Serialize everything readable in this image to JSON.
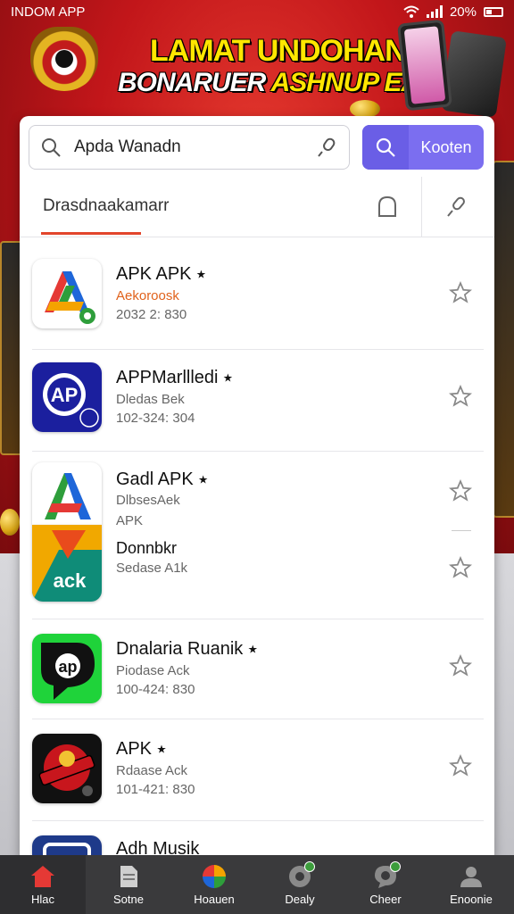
{
  "status_bar": {
    "carrier": "INDOM APP",
    "battery": "20%"
  },
  "banner": {
    "title_line1": "LAMAT UNDOHAN",
    "title_line2_a": "BONARUER ",
    "title_line2_b": "ASHNUP EAWS"
  },
  "search": {
    "query": "Apda Wanadn",
    "button_label": "Kooten"
  },
  "tabs": {
    "active_label": "Drasdnaakamarr"
  },
  "apps": [
    {
      "name": "APK APK ⭑",
      "sub1": "Aekoroosk",
      "sub2": "2032 2: 830",
      "sub1_color": "#e0621c"
    },
    {
      "name": "APPMarllledi ⭑",
      "sub1": "Dledas Bek",
      "sub2": "102-324: 304"
    },
    {
      "name": "Gadl APK ⭑",
      "sub1": "DlbsesAek",
      "sub2": "APK"
    },
    {
      "name": "Donnbkr",
      "sub1": "Sedase A1k",
      "sub2": ""
    },
    {
      "name": "Dnalaria Ruanik ⭑",
      "sub1": "Piodase Ack",
      "sub2": "100-424: 830"
    },
    {
      "name": "APK ⭑",
      "sub1": "Rdaase Ack",
      "sub2": "101-421: 830"
    },
    {
      "name": "Adh Musik",
      "sub1": "",
      "sub2": ""
    }
  ],
  "bottom_nav": [
    {
      "label": "Hlac",
      "icon": "home-icon",
      "active": true
    },
    {
      "label": "Sotne",
      "icon": "document-icon"
    },
    {
      "label": "Hoauen",
      "icon": "color-wheel-icon"
    },
    {
      "label": "Dealy",
      "icon": "chat-icon"
    },
    {
      "label": "Cheer",
      "icon": "chat-bubble-icon"
    },
    {
      "label": "Enoonie",
      "icon": "profile-icon"
    }
  ],
  "colors": {
    "accent": "#7b6ef0",
    "tab_underline": "#e2452b",
    "banner_red": "#c2161a",
    "nav_bg": "#3a3a3c"
  }
}
